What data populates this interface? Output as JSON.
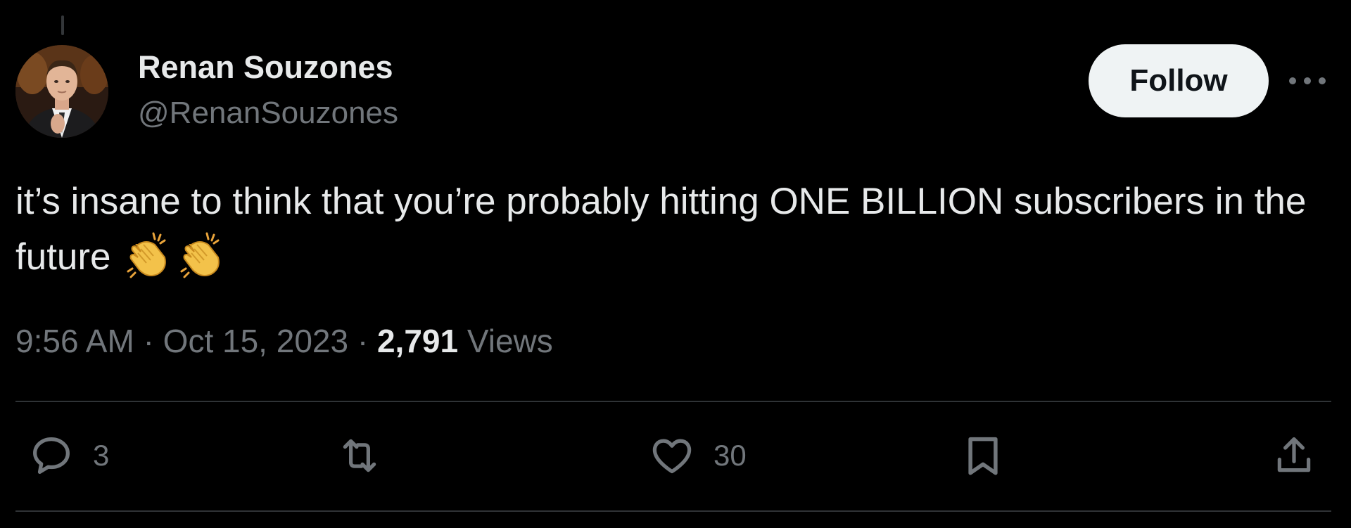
{
  "author": {
    "display_name": "Renan Souzones",
    "handle": "@RenanSouzones"
  },
  "follow_button": {
    "label": "Follow"
  },
  "tweet": {
    "text": "it’s insane to think that you’re probably hitting ONE BILLION subscribers in the future",
    "emoji": [
      "clapping-hands",
      "clapping-hands"
    ],
    "time": "9:56 AM",
    "separator": "·",
    "date": "Oct 15, 2023",
    "views_count": "2,791",
    "views_label": "Views"
  },
  "actions": {
    "reply_count": "3",
    "retweet_count": "",
    "like_count": "30"
  },
  "colors": {
    "background": "#000000",
    "text_primary": "#e7e9ea",
    "text_secondary": "#71767b",
    "divider": "#2f3336",
    "follow_bg": "#eff3f4",
    "follow_text": "#0f1419"
  }
}
